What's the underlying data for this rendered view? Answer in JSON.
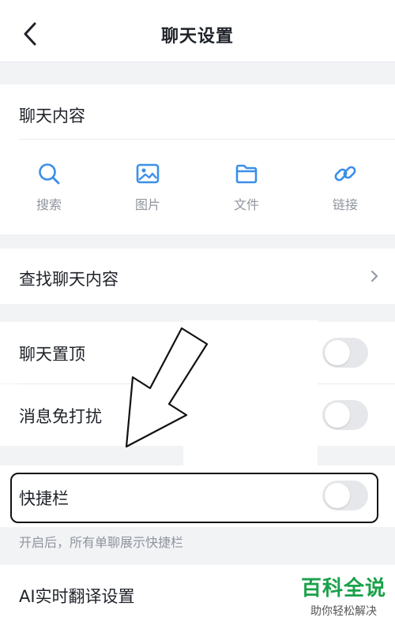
{
  "header": {
    "title": "聊天设置"
  },
  "chat_content": {
    "title": "聊天内容",
    "items": [
      {
        "label": "搜索",
        "icon": "search-icon"
      },
      {
        "label": "图片",
        "icon": "image-icon"
      },
      {
        "label": "文件",
        "icon": "folder-icon"
      },
      {
        "label": "链接",
        "icon": "link-icon"
      }
    ],
    "icon_color": "#3b8fe8"
  },
  "find_content": {
    "label": "查找聊天内容"
  },
  "settings": {
    "pin_chat": {
      "label": "聊天置顶",
      "enabled": false
    },
    "mute": {
      "label": "消息免打扰",
      "enabled": false
    },
    "quick_bar": {
      "label": "快捷栏",
      "enabled": false,
      "hint": "开启后，所有单聊展示快捷栏"
    },
    "translate": {
      "label": "AI实时翻译设置"
    }
  },
  "watermark": {
    "main": "百科全说",
    "sub": "助你轻松解决",
    "color": "#1aa14a"
  }
}
